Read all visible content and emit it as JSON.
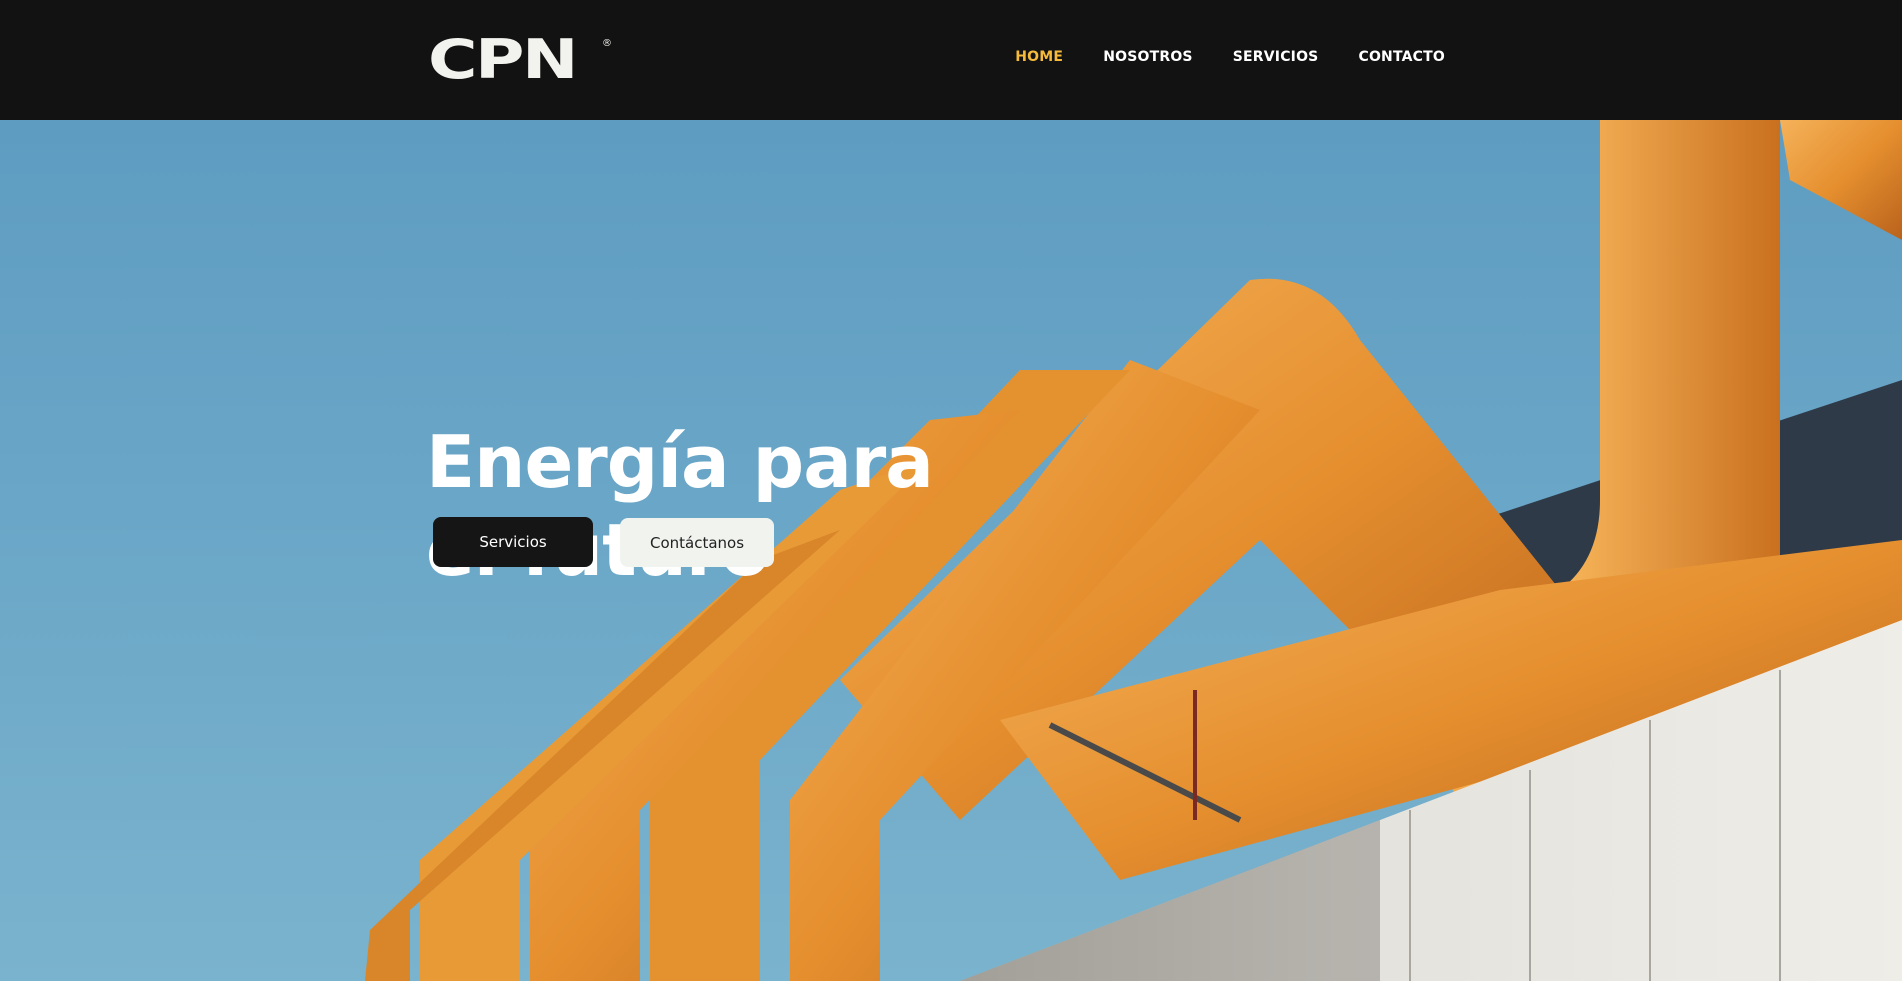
{
  "header": {
    "logo_text": "CPN",
    "logo_mark": "®",
    "nav": [
      {
        "label": "HOME",
        "active": true
      },
      {
        "label": "NOSOTROS",
        "active": false
      },
      {
        "label": "SERVICIOS",
        "active": false
      },
      {
        "label": "CONTACTO",
        "active": false
      }
    ]
  },
  "hero": {
    "title_line1": "Energía para",
    "title_line2": "el futuro",
    "primary_button": "Servicios",
    "secondary_button": "Contáctanos",
    "image": "industrial-orange-pipes-photo"
  },
  "colors": {
    "header_bg": "#121212",
    "nav_active": "#f5b93b",
    "sky": "#6aa6c7",
    "pipe": "#e8922e",
    "button_dark": "#151515",
    "button_light": "#f1f3ef"
  }
}
